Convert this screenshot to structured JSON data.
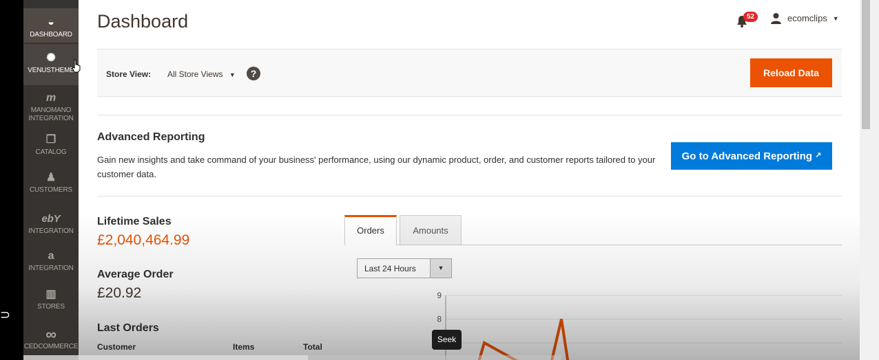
{
  "sidebar": {
    "items": [
      {
        "label": "DASHBOARD",
        "icon": "speedometer-icon",
        "glyph": "◒"
      },
      {
        "label": "VENUSTHEME",
        "icon": "sparkle-icon",
        "glyph": "✺"
      },
      {
        "label": "MANOMANO INTEGRATION",
        "icon": "manomano-logo-icon",
        "glyph": "m"
      },
      {
        "label": "CATALOG",
        "icon": "cube-icon",
        "glyph": "❒"
      },
      {
        "label": "CUSTOMERS",
        "icon": "person-icon",
        "glyph": "♟"
      },
      {
        "label": "INTEGRATION",
        "icon": "ebay-logo-icon",
        "glyph": "ebY"
      },
      {
        "label": "INTEGRATION",
        "icon": "amazon-logo-icon",
        "glyph": "a"
      },
      {
        "label": "STORES",
        "icon": "store-icon",
        "glyph": "▥"
      },
      {
        "label": "CEDCOMMERCE",
        "icon": "infinity-icon",
        "glyph": "∞"
      }
    ]
  },
  "header": {
    "title": "Dashboard",
    "notifications_count": "52",
    "user_name": "ecomclips"
  },
  "toolbar": {
    "store_view_label": "Store View:",
    "store_view_value": "All Store Views",
    "help_glyph": "?",
    "reload_label": "Reload Data"
  },
  "advanced": {
    "title": "Advanced Reporting",
    "description": "Gain new insights and take command of your business' performance, using our dynamic product, order, and customer reports tailored to your customer data.",
    "button_label": "Go to Advanced Reporting"
  },
  "stats": {
    "lifetime_label": "Lifetime Sales",
    "lifetime_value": "£2,040,464.99",
    "average_label": "Average Order",
    "average_value": "£20.92",
    "last_orders_label": "Last Orders",
    "columns": [
      "Customer",
      "Items",
      "Total"
    ]
  },
  "tabs": [
    {
      "label": "Orders",
      "active": true
    },
    {
      "label": "Amounts",
      "active": false
    }
  ],
  "period": {
    "selected": "Last 24 Hours"
  },
  "chart_data": {
    "type": "line",
    "y_ticks": [
      9,
      8,
      7
    ],
    "series": [
      {
        "values": [
          0,
          7,
          0,
          8,
          0
        ]
      }
    ],
    "line_color": "#eb5202"
  },
  "video": {
    "tooltip": "Seek",
    "progress": 0.53
  },
  "colors": {
    "accent": "#eb5202",
    "primary_button": "#007bdb",
    "sidebar": "#373330"
  }
}
